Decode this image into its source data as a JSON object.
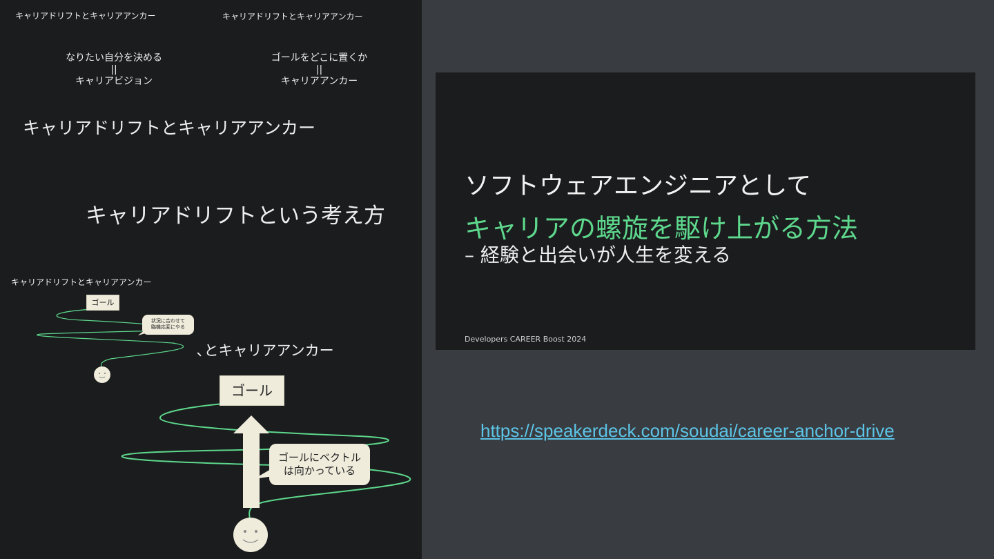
{
  "left_panel": {
    "small_title_1": "キャリアドリフトとキャリアアンカー",
    "small_title_2": "キャリアドリフトとキャリアアンカー",
    "vision_lines": [
      "なりたい自分を決める",
      "||",
      "キャリアビジョン"
    ],
    "anchor_lines": [
      "ゴールをどこに置くか",
      "||",
      "キャリアアンカー"
    ],
    "medium_title": "キャリアドリフトとキャリアアンカー",
    "large_title": "キャリアドリフトという考え方",
    "small_title_3": "キャリアドリフトとキャリアアンカー",
    "small_goal": "ゴール",
    "small_bubble_lines": [
      "状況に合わせて",
      "臨機応変にやる"
    ],
    "partial_title": "､とキャリアアンカー",
    "big_goal": "ゴール",
    "big_bubble_lines": [
      "ゴールにベクトル",
      "は向かっている"
    ]
  },
  "slide": {
    "line1": "ソフトウェアエンジニアとして",
    "line2": "キャリアの螺旋を駆け上がる方法",
    "line3": "– 経験と出会いが人生を変える",
    "footer": "Developers CAREER Boost 2024"
  },
  "link": {
    "text": "https://speakerdeck.com/soudai/career-anchor-drive"
  },
  "colors": {
    "background": "#393c41",
    "slide_bg": "#1b1c1e",
    "accent_green": "#5dd88c",
    "link": "#5cc4e6",
    "cream": "#efecdc"
  }
}
